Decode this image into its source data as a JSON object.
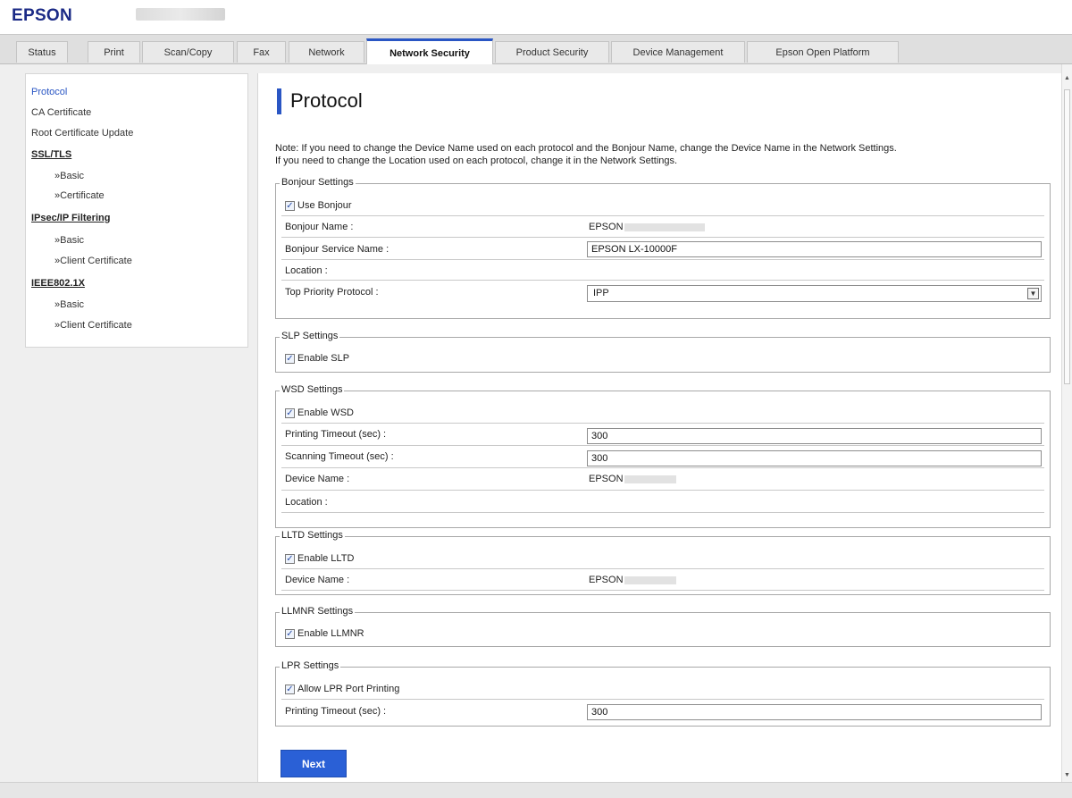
{
  "brand": {
    "logo": "EPSON"
  },
  "tabs": [
    {
      "label": "Status"
    },
    {
      "label": "Print"
    },
    {
      "label": "Scan/Copy"
    },
    {
      "label": "Fax"
    },
    {
      "label": "Network"
    },
    {
      "label": "Network Security",
      "active": true
    },
    {
      "label": "Product Security"
    },
    {
      "label": "Device Management"
    },
    {
      "label": "Epson Open Platform"
    }
  ],
  "sidebar": {
    "protocol": "Protocol",
    "ca_certificate": "CA Certificate",
    "root_cert_update": "Root Certificate Update",
    "ssl_tls": "SSL/TLS",
    "ssl_basic": "»Basic",
    "ssl_certificate": "»Certificate",
    "ipsec": "IPsec/IP Filtering",
    "ipsec_basic": "»Basic",
    "ipsec_client_cert": "»Client Certificate",
    "ieee": "IEEE802.1X",
    "ieee_basic": "»Basic",
    "ieee_client_cert": "»Client Certificate"
  },
  "page": {
    "title": "Protocol",
    "note_line1": "Note: If you need to change the Device Name used on each protocol and the Bonjour Name, change the Device Name in the Network Settings.",
    "note_line2": "If you need to change the Location used on each protocol, change it in the Network Settings."
  },
  "bonjour": {
    "legend": "Bonjour Settings",
    "use_label": "Use Bonjour",
    "use_checked": true,
    "name_label": "Bonjour Name :",
    "name_value": "EPSON",
    "service_label": "Bonjour Service Name :",
    "service_value": "EPSON LX-10000F",
    "location_label": "Location :",
    "priority_label": "Top Priority Protocol :",
    "priority_value": "IPP"
  },
  "slp": {
    "legend": "SLP Settings",
    "enable_label": "Enable SLP",
    "enable_checked": true
  },
  "wsd": {
    "legend": "WSD Settings",
    "enable_label": "Enable WSD",
    "enable_checked": true,
    "print_timeout_label": "Printing Timeout (sec) :",
    "print_timeout_value": "300",
    "scan_timeout_label": "Scanning Timeout (sec) :",
    "scan_timeout_value": "300",
    "device_name_label": "Device Name :",
    "device_name_value": "EPSON",
    "location_label": "Location :"
  },
  "lltd": {
    "legend": "LLTD Settings",
    "enable_label": "Enable LLTD",
    "enable_checked": true,
    "device_name_label": "Device Name :",
    "device_name_value": "EPSON"
  },
  "llmnr": {
    "legend": "LLMNR Settings",
    "enable_label": "Enable LLMNR",
    "enable_checked": true
  },
  "lpr": {
    "legend": "LPR Settings",
    "allow_label": "Allow LPR Port Printing",
    "allow_checked": true,
    "print_timeout_label": "Printing Timeout (sec) :",
    "print_timeout_value": "300"
  },
  "actions": {
    "next_label": "Next"
  },
  "colors": {
    "accent": "#2a56c4",
    "button": "#2a60d6",
    "brand": "#1b2a86"
  }
}
